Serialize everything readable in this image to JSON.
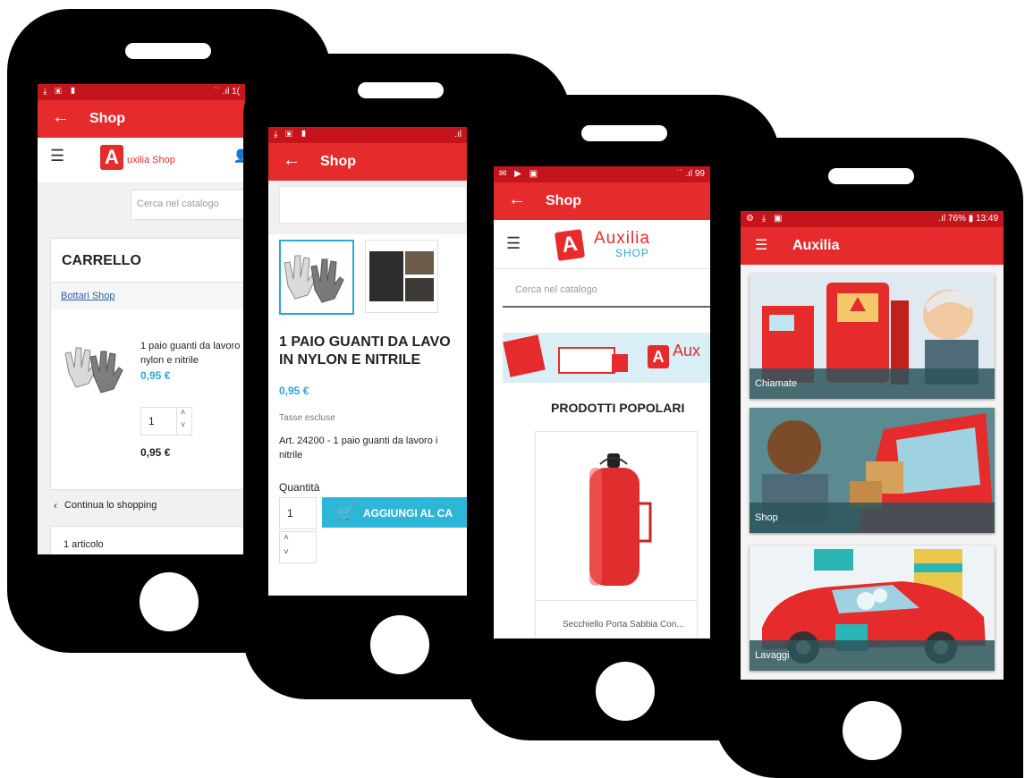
{
  "phone1": {
    "status_right": "˙˙ .ıl 1(",
    "appbar_title": "Shop",
    "logo_text": "uxilia Shop",
    "search_placeholder": "Cerca nel catalogo",
    "cart_title": "CARRELLO",
    "shop_link": "Bottari Shop",
    "product_name_1": "1 paio guanti da lavoro",
    "product_name_2": "nylon e nitrile",
    "product_price": "0,95 €",
    "quantity": "1",
    "line_total": "0,95 €",
    "continue_link": "Continua lo shopping",
    "items_count": "1 articolo"
  },
  "phone2": {
    "appbar_title": "Shop",
    "product_title_1": "1 PAIO GUANTI DA LAVO",
    "product_title_2": "IN NYLON E NITRILE",
    "price": "0,95 €",
    "tax_note": "Tasse escluse",
    "description_1": "Art. 24200 - 1 paio guanti da lavoro i",
    "description_2": "nitrile",
    "quantity_label": "Quantità",
    "quantity_value": "1",
    "add_to_cart": "AGGIUNGI AL CA"
  },
  "phone3": {
    "status_right": "˙˙ .ıl 99",
    "appbar_title": "Shop",
    "logo_line1": "Auxilia",
    "logo_line2": "SHOP",
    "search_placeholder": "Cerca nel catalogo",
    "banner_text": "Aux",
    "section_title": "PRODOTTI POPOLARI",
    "product_name": "Secchiello Porta Sabbia Con..."
  },
  "phone4": {
    "status_right": ".ıl 76% ▮ 13:49",
    "appbar_title": "Auxilia",
    "cards": [
      {
        "label": "Chiamate"
      },
      {
        "label": "Shop"
      },
      {
        "label": "Lavaggi"
      }
    ]
  },
  "colors": {
    "brand_red": "#e52b2b",
    "status_red": "#c4151c",
    "price_blue": "#2aa8d6",
    "button_cyan": "#2cb7d9"
  }
}
